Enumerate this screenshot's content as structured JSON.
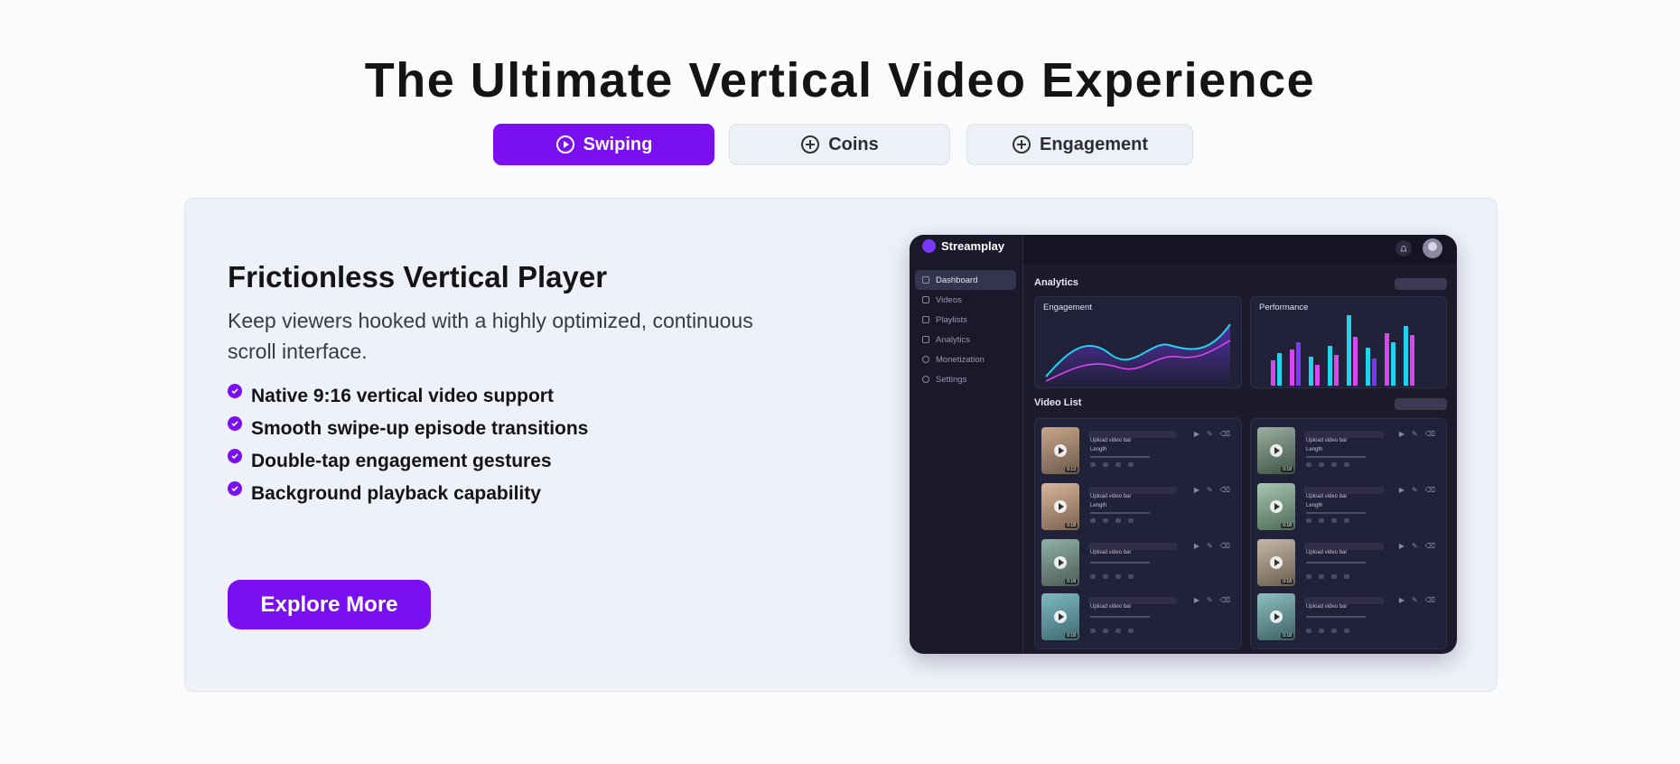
{
  "heading": "The Ultimate Vertical Video Experience",
  "tabs": [
    {
      "label": "Swiping",
      "icon": "play-circle-icon",
      "active": true
    },
    {
      "label": "Coins",
      "icon": "plus-circle-icon",
      "active": false
    },
    {
      "label": "Engagement",
      "icon": "plus-circle-icon",
      "active": false
    }
  ],
  "feature": {
    "title": "Frictionless Vertical Player",
    "description": "Keep viewers hooked with a highly optimized, continuous scroll interface.",
    "bullets": [
      "Native 9:16 vertical video support",
      "Smooth swipe-up episode transitions",
      "Double-tap engagement gestures",
      "Background playback capability"
    ],
    "cta": "Explore More"
  },
  "dashboard": {
    "brand": "Streamplay",
    "nav": [
      "Dashboard",
      "Videos",
      "Playlists",
      "Analytics",
      "Monetization",
      "Settings"
    ],
    "analytics_title": "Analytics",
    "engagement_label": "Engagement",
    "performance_label": "Performance",
    "video_list_title": "Video List",
    "video_title": "Upload video bar",
    "video_sub": "Length",
    "durations": [
      "0:13",
      "0:18",
      "0:18",
      "0:18",
      "0:18",
      "0:18",
      "0:18",
      "0:18"
    ]
  },
  "colors": {
    "accent": "#7a10f0",
    "card_bg": "#eef1fa",
    "dash_bg": "#1c1b2c",
    "chart_cyan": "#22d3ee",
    "chart_magenta": "#d946ef"
  }
}
